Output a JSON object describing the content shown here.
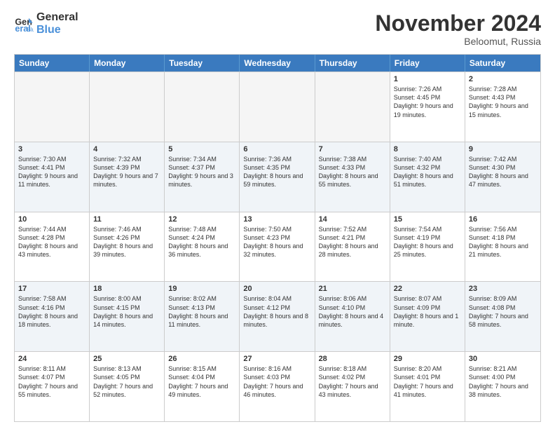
{
  "logo": {
    "line1": "General",
    "line2": "Blue"
  },
  "title": "November 2024",
  "location": "Beloomut, Russia",
  "header": {
    "days": [
      "Sunday",
      "Monday",
      "Tuesday",
      "Wednesday",
      "Thursday",
      "Friday",
      "Saturday"
    ]
  },
  "rows": [
    [
      {
        "day": "",
        "text": ""
      },
      {
        "day": "",
        "text": ""
      },
      {
        "day": "",
        "text": ""
      },
      {
        "day": "",
        "text": ""
      },
      {
        "day": "",
        "text": ""
      },
      {
        "day": "1",
        "text": "Sunrise: 7:26 AM\nSunset: 4:45 PM\nDaylight: 9 hours and 19 minutes."
      },
      {
        "day": "2",
        "text": "Sunrise: 7:28 AM\nSunset: 4:43 PM\nDaylight: 9 hours and 15 minutes."
      }
    ],
    [
      {
        "day": "3",
        "text": "Sunrise: 7:30 AM\nSunset: 4:41 PM\nDaylight: 9 hours and 11 minutes."
      },
      {
        "day": "4",
        "text": "Sunrise: 7:32 AM\nSunset: 4:39 PM\nDaylight: 9 hours and 7 minutes."
      },
      {
        "day": "5",
        "text": "Sunrise: 7:34 AM\nSunset: 4:37 PM\nDaylight: 9 hours and 3 minutes."
      },
      {
        "day": "6",
        "text": "Sunrise: 7:36 AM\nSunset: 4:35 PM\nDaylight: 8 hours and 59 minutes."
      },
      {
        "day": "7",
        "text": "Sunrise: 7:38 AM\nSunset: 4:33 PM\nDaylight: 8 hours and 55 minutes."
      },
      {
        "day": "8",
        "text": "Sunrise: 7:40 AM\nSunset: 4:32 PM\nDaylight: 8 hours and 51 minutes."
      },
      {
        "day": "9",
        "text": "Sunrise: 7:42 AM\nSunset: 4:30 PM\nDaylight: 8 hours and 47 minutes."
      }
    ],
    [
      {
        "day": "10",
        "text": "Sunrise: 7:44 AM\nSunset: 4:28 PM\nDaylight: 8 hours and 43 minutes."
      },
      {
        "day": "11",
        "text": "Sunrise: 7:46 AM\nSunset: 4:26 PM\nDaylight: 8 hours and 39 minutes."
      },
      {
        "day": "12",
        "text": "Sunrise: 7:48 AM\nSunset: 4:24 PM\nDaylight: 8 hours and 36 minutes."
      },
      {
        "day": "13",
        "text": "Sunrise: 7:50 AM\nSunset: 4:23 PM\nDaylight: 8 hours and 32 minutes."
      },
      {
        "day": "14",
        "text": "Sunrise: 7:52 AM\nSunset: 4:21 PM\nDaylight: 8 hours and 28 minutes."
      },
      {
        "day": "15",
        "text": "Sunrise: 7:54 AM\nSunset: 4:19 PM\nDaylight: 8 hours and 25 minutes."
      },
      {
        "day": "16",
        "text": "Sunrise: 7:56 AM\nSunset: 4:18 PM\nDaylight: 8 hours and 21 minutes."
      }
    ],
    [
      {
        "day": "17",
        "text": "Sunrise: 7:58 AM\nSunset: 4:16 PM\nDaylight: 8 hours and 18 minutes."
      },
      {
        "day": "18",
        "text": "Sunrise: 8:00 AM\nSunset: 4:15 PM\nDaylight: 8 hours and 14 minutes."
      },
      {
        "day": "19",
        "text": "Sunrise: 8:02 AM\nSunset: 4:13 PM\nDaylight: 8 hours and 11 minutes."
      },
      {
        "day": "20",
        "text": "Sunrise: 8:04 AM\nSunset: 4:12 PM\nDaylight: 8 hours and 8 minutes."
      },
      {
        "day": "21",
        "text": "Sunrise: 8:06 AM\nSunset: 4:10 PM\nDaylight: 8 hours and 4 minutes."
      },
      {
        "day": "22",
        "text": "Sunrise: 8:07 AM\nSunset: 4:09 PM\nDaylight: 8 hours and 1 minute."
      },
      {
        "day": "23",
        "text": "Sunrise: 8:09 AM\nSunset: 4:08 PM\nDaylight: 7 hours and 58 minutes."
      }
    ],
    [
      {
        "day": "24",
        "text": "Sunrise: 8:11 AM\nSunset: 4:07 PM\nDaylight: 7 hours and 55 minutes."
      },
      {
        "day": "25",
        "text": "Sunrise: 8:13 AM\nSunset: 4:05 PM\nDaylight: 7 hours and 52 minutes."
      },
      {
        "day": "26",
        "text": "Sunrise: 8:15 AM\nSunset: 4:04 PM\nDaylight: 7 hours and 49 minutes."
      },
      {
        "day": "27",
        "text": "Sunrise: 8:16 AM\nSunset: 4:03 PM\nDaylight: 7 hours and 46 minutes."
      },
      {
        "day": "28",
        "text": "Sunrise: 8:18 AM\nSunset: 4:02 PM\nDaylight: 7 hours and 43 minutes."
      },
      {
        "day": "29",
        "text": "Sunrise: 8:20 AM\nSunset: 4:01 PM\nDaylight: 7 hours and 41 minutes."
      },
      {
        "day": "30",
        "text": "Sunrise: 8:21 AM\nSunset: 4:00 PM\nDaylight: 7 hours and 38 minutes."
      }
    ]
  ]
}
